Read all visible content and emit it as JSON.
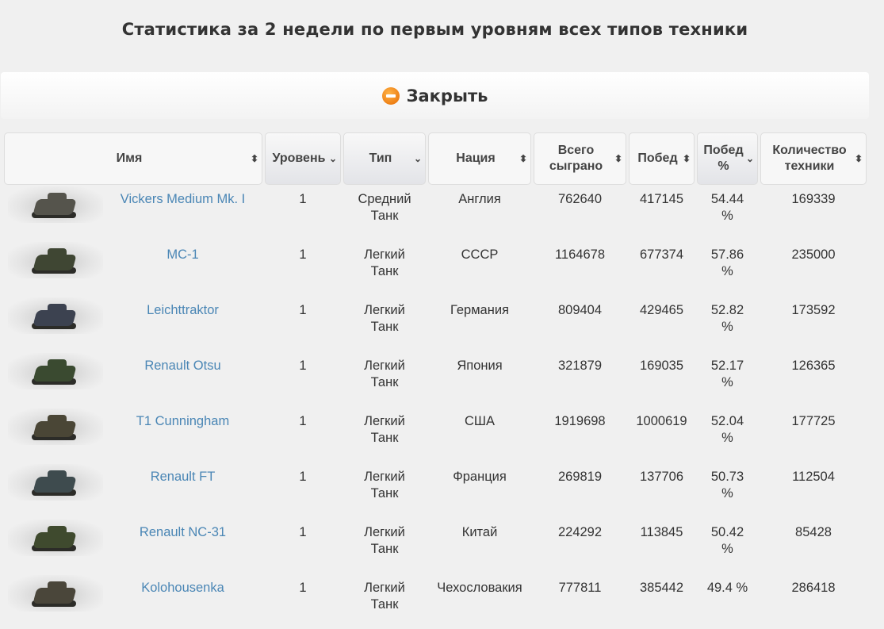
{
  "title": "Статистика за 2 недели по первым уровням всех типов техники",
  "close_label": "Закрыть",
  "headers": {
    "name": "Имя",
    "level": "Уровень",
    "type": "Тип",
    "nation": "Нация",
    "total_line1": "Всего",
    "total_line2": "сыграно",
    "wins": "Побед",
    "pct_line1": "Побед",
    "pct_line2": "%",
    "count_line1": "Количество",
    "count_line2": "техники"
  },
  "rows": [
    {
      "name": "Vickers Medium Mk. I",
      "level": "1",
      "type1": "Средний",
      "type2": "Танк",
      "nation": "Англия",
      "total": "762640",
      "wins": "417145",
      "pct1": "54.44",
      "pct2": "%",
      "count": "169339",
      "hull": "#55544c"
    },
    {
      "name": "MC-1",
      "level": "1",
      "type1": "Легкий",
      "type2": "Танк",
      "nation": "СССР",
      "total": "1164678",
      "wins": "677374",
      "pct1": "57.86",
      "pct2": "%",
      "count": "235000",
      "hull": "#3f4633"
    },
    {
      "name": "Leichttraktor",
      "level": "1",
      "type1": "Легкий",
      "type2": "Танк",
      "nation": "Германия",
      "total": "809404",
      "wins": "429465",
      "pct1": "52.82",
      "pct2": "%",
      "count": "173592",
      "hull": "#3c4250"
    },
    {
      "name": "Renault Otsu",
      "level": "1",
      "type1": "Легкий",
      "type2": "Танк",
      "nation": "Япония",
      "total": "321879",
      "wins": "169035",
      "pct1": "52.17",
      "pct2": "%",
      "count": "126365",
      "hull": "#3a4a30"
    },
    {
      "name": "T1 Cunningham",
      "level": "1",
      "type1": "Легкий",
      "type2": "Танк",
      "nation": "США",
      "total": "1919698",
      "wins": "1000619",
      "pct1": "52.04",
      "pct2": "%",
      "count": "177725",
      "hull": "#4a4636"
    },
    {
      "name": "Renault FT",
      "level": "1",
      "type1": "Легкий",
      "type2": "Танк",
      "nation": "Франция",
      "total": "269819",
      "wins": "137706",
      "pct1": "50.73",
      "pct2": "%",
      "count": "112504",
      "hull": "#3e4b4e"
    },
    {
      "name": "Renault NC-31",
      "level": "1",
      "type1": "Легкий",
      "type2": "Танк",
      "nation": "Китай",
      "total": "224292",
      "wins": "113845",
      "pct1": "50.42",
      "pct2": "%",
      "count": "85428",
      "hull": "#3f4a2e"
    },
    {
      "name": "Kolohousenka",
      "level": "1",
      "type1": "Легкий",
      "type2": "Танк",
      "nation": "Чехословакия",
      "total": "777811",
      "wins": "385442",
      "pct1": "49.4 %",
      "pct2": "",
      "count": "286418",
      "hull": "#4a463a"
    }
  ]
}
